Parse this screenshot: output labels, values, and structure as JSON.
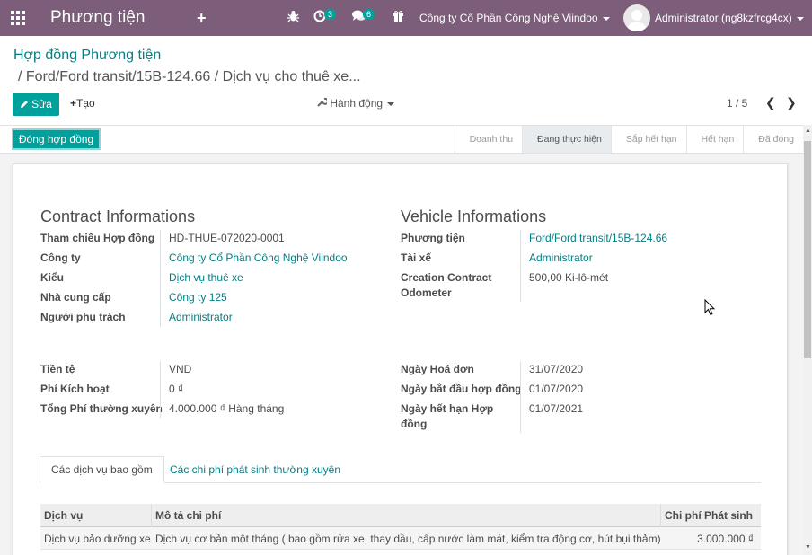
{
  "topbar": {
    "app_title": "Phương tiện",
    "activity_count": "3",
    "message_count": "6",
    "company": "Công ty Cổ Phần Công Nghệ Viindoo",
    "user": "Administrator (ng8kzfrcg4cx)",
    "colors": {
      "bar": "#7c5e7a",
      "badge": "#00a09d"
    }
  },
  "breadcrumb": {
    "parent": "Hợp đồng Phương tiện",
    "current": "/ Ford/Ford transit/15B-124.66 / Dịch vụ cho thuê xe..."
  },
  "toolbar": {
    "edit_label": "Sửa",
    "create_label": "Tạo",
    "actions_label": "Hành động",
    "pager": "1 / 5"
  },
  "statusbar": {
    "close_button": "Đóng hợp đồng",
    "stages": [
      "Doanh thu",
      "Đang thực hiện",
      "Sắp hết hạn",
      "Hết hạn",
      "Đã đóng"
    ],
    "active_stage": "Đang thực hiện"
  },
  "contract": {
    "title": "Contract Informations",
    "fields": [
      {
        "label": "Tham chiếu Hợp đồng",
        "value": "HD-THUE-072020-0001"
      },
      {
        "label": "Công ty",
        "value": "Công ty Cổ Phần Công Nghệ Viindoo"
      },
      {
        "label": "Kiểu",
        "value": "Dịch vụ thuê xe"
      },
      {
        "label": "Nhà cung cấp",
        "value": "Công ty 125"
      },
      {
        "label": "Người phụ trách",
        "value": "Administrator"
      }
    ]
  },
  "vehicle": {
    "title": "Vehicle Informations",
    "fields": [
      {
        "label": "Phương tiện",
        "value": "Ford/Ford transit/15B-124.66"
      },
      {
        "label": "Tài xế",
        "value": "Administrator"
      },
      {
        "label": "Creation Contract Odometer",
        "value": "500,00  Ki-lô-mét"
      }
    ]
  },
  "finance": {
    "fields": [
      {
        "label": "Tiền tệ",
        "value": "VND"
      },
      {
        "label": "Phí Kích hoạt",
        "value": "0 ₫"
      },
      {
        "label": "Tổng Phí thường xuyên",
        "value": "4.000.000 ₫  Hàng tháng"
      }
    ]
  },
  "dates": {
    "fields": [
      {
        "label": "Ngày Hoá đơn",
        "value": "31/07/2020"
      },
      {
        "label": "Ngày bắt đầu hợp đồng",
        "value": "01/07/2020"
      },
      {
        "label": "Ngày hết hạn Hợp đồng",
        "value": "01/07/2021"
      }
    ]
  },
  "tabs": [
    "Các dịch vụ bao gồm",
    "Các chi phí phát sinh thường xuyên"
  ],
  "table": {
    "columns": [
      "Dịch vụ",
      "Mô tả chi phí",
      "Chi phí Phát sinh"
    ],
    "rows": [
      [
        "Dịch vụ bảo dưỡng xe",
        "Dịch vụ cơ bản một tháng ( bao gồm rửa xe, thay dầu, cấp nước làm mát, kiểm tra động cơ, hút bụi thảm)",
        "3.000.000 ₫"
      ]
    ]
  }
}
